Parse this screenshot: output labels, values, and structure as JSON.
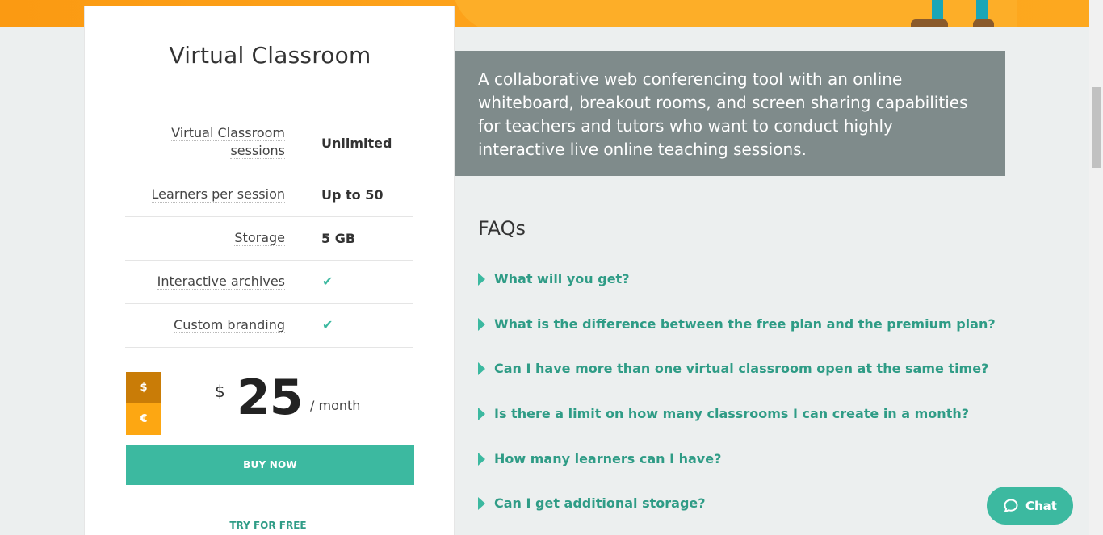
{
  "card": {
    "title": "Virtual Classroom",
    "features": [
      {
        "label": "Virtual Classroom sessions",
        "value": "Unlimited"
      },
      {
        "label": "Learners per session",
        "value": "Up to 50"
      },
      {
        "label": "Storage",
        "value": "5 GB"
      },
      {
        "label": "Interactive archives",
        "value": "✔"
      },
      {
        "label": "Custom branding",
        "value": "✔"
      }
    ],
    "currency": {
      "usd": "$",
      "eur": "€",
      "selected": "$"
    },
    "price": {
      "symbol": "$",
      "amount": "25",
      "period": "/ month"
    },
    "buy_label": "BUY NOW",
    "try_label": "TRY FOR FREE"
  },
  "description": "A collaborative web conferencing tool with an online whiteboard, breakout rooms, and screen sharing capabilities for teachers and tutors who want to conduct highly interactive live online teaching sessions.",
  "faq": {
    "title": "FAQs",
    "items": [
      "What will you get?",
      "What is the difference between the free plan and the premium plan?",
      "Can I have more than one virtual classroom open at the same time?",
      "Is there a limit on how many classrooms I can create in a month?",
      "How many learners can I have?",
      "Can I get additional storage?"
    ]
  },
  "chat": {
    "label": "Chat"
  },
  "colors": {
    "accent": "#3cb9a0",
    "orange": "#fda712",
    "dark_orange": "#c97c07",
    "desc_bg": "#7f8b8b"
  }
}
